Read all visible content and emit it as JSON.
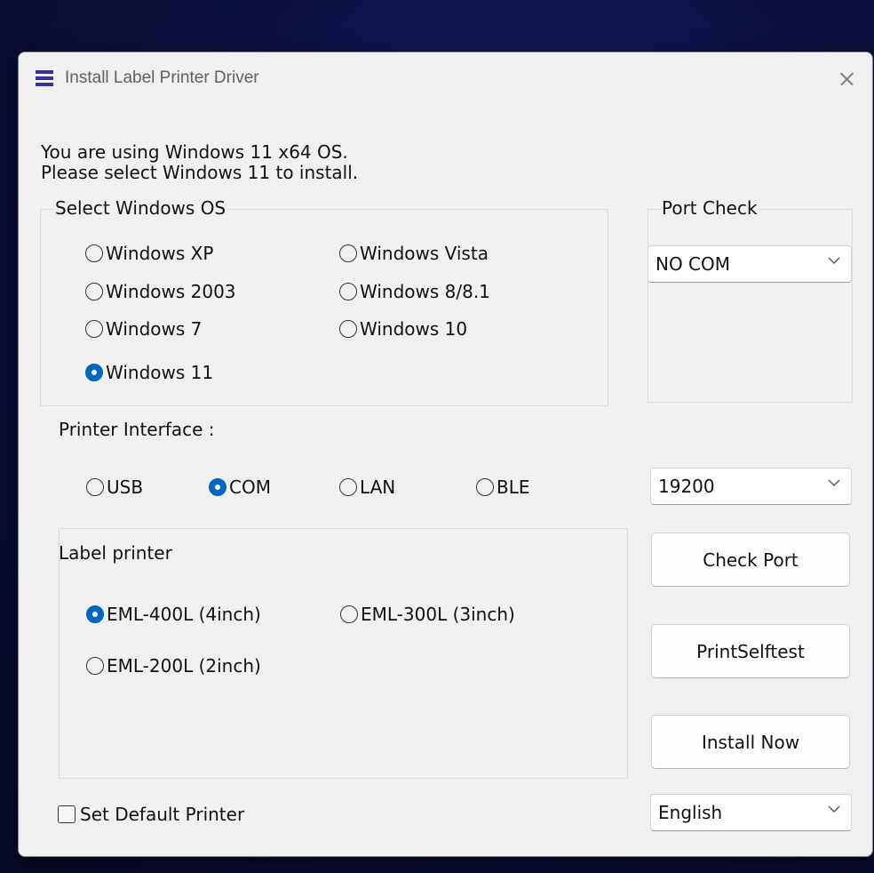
{
  "window": {
    "title": "Install Label Printer Driver"
  },
  "info": {
    "line1": "You are using Windows 11 x64 OS.",
    "line2": "Please select Windows 11 to install."
  },
  "os_group": {
    "legend": "Select Windows OS",
    "options": [
      "Windows XP",
      "Windows Vista",
      "Windows 2003",
      "Windows 8/8.1",
      "Windows 7",
      "Windows 10",
      "Windows 11"
    ],
    "selected": "Windows 11"
  },
  "port_check": {
    "legend": "Port Check",
    "value": "NO COM"
  },
  "interface": {
    "label": "Printer Interface :",
    "options": [
      "USB",
      "COM",
      "LAN",
      "BLE"
    ],
    "selected": "COM",
    "baud": "19200"
  },
  "label_printer": {
    "legend": "Label printer",
    "options": [
      "EML-400L (4inch)",
      "EML-300L (3inch)",
      "EML-200L (2inch)"
    ],
    "selected": "EML-400L (4inch)"
  },
  "buttons": {
    "check_port": "Check Port",
    "print_selftest": "PrintSelftest",
    "install_now": "Install Now"
  },
  "default_printer": {
    "label": "Set Default Printer",
    "checked": false
  },
  "language": {
    "value": "English"
  },
  "colors": {
    "accent": "#0067c0",
    "icon": "#3a2f9e",
    "window_bg": "#f0f0f0"
  }
}
